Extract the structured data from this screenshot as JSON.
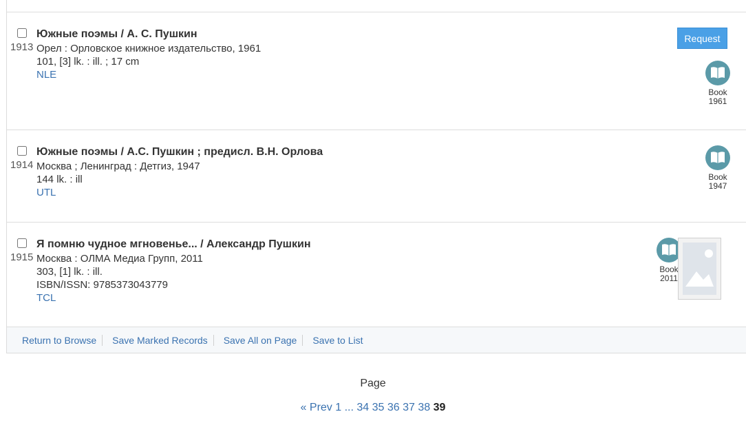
{
  "records": [
    {
      "number": "1913",
      "title": "Южные поэмы / А. С. Пушкин",
      "lines": [
        "Орел : Орловское книжное издательство, 1961",
        "101, [3] lk. : ill. ; 17 cm"
      ],
      "holding": "NLE",
      "request_label": "Request",
      "format": {
        "type": "Book",
        "year": "1961",
        "icon": "book-icon"
      }
    },
    {
      "number": "1914",
      "title": "Южные поэмы / А.С. Пушкин ; предисл. В.Н. Орлова",
      "lines": [
        "Москва ; Ленинград : Детгиз, 1947",
        "144 lk. : ill"
      ],
      "holding": "UTL",
      "format": {
        "type": "Book",
        "year": "1947",
        "icon": "book-icon"
      }
    },
    {
      "number": "1915",
      "title": "Я помню чудное мгновенье... / Александр Пушкин",
      "lines": [
        "Москва : ОЛМА Медиа Групп, 2011",
        "303, [1] lk. : ill.",
        "ISBN/ISSN:  9785373043779"
      ],
      "holding": "TCL",
      "format": {
        "type": "Book",
        "year": "2011",
        "icon": "book-icon"
      },
      "cover": "image-placeholder-icon"
    }
  ],
  "toolbar": {
    "return_label": "Return to Browse",
    "save_marked_label": "Save Marked Records",
    "save_all_label": "Save All on Page",
    "save_list_label": "Save to List"
  },
  "pagination": {
    "label": "Page",
    "prev_label": "« Prev",
    "first_page": "1",
    "ellipsis": "...",
    "pages": [
      "34",
      "35",
      "36",
      "37",
      "38"
    ],
    "current": "39"
  },
  "colors": {
    "link": "#3a72b0",
    "request_button": "#4aa0e6",
    "format_icon": "#5b9aa8"
  }
}
